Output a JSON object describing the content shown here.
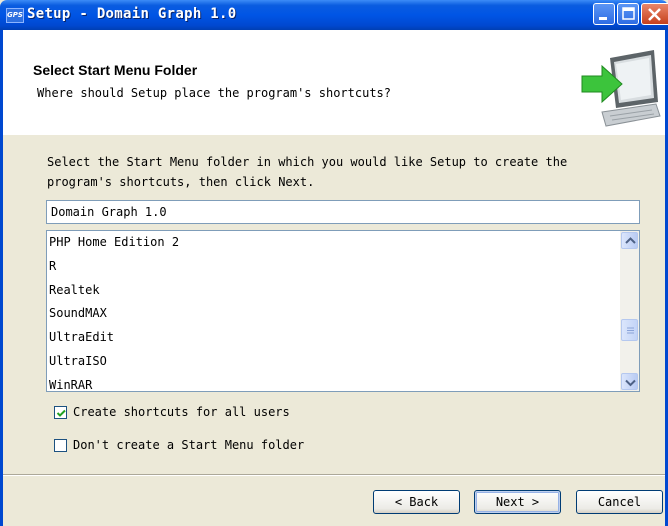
{
  "window": {
    "title": "Setup - Domain Graph 1.0",
    "app_icon_text": "GPS"
  },
  "header": {
    "title": "Select Start Menu Folder",
    "subtitle": "Where should Setup place the program's shortcuts?"
  },
  "body": {
    "instruction_line1": "Select the Start Menu folder in which you would like Setup to create the",
    "instruction_line2": "program's shortcuts, then click Next.",
    "folder_value": "Domain Graph 1.0",
    "folders": [
      "PHP Home Edition 2",
      "R",
      "Realtek",
      "SoundMAX",
      "UltraEdit",
      "UltraISO",
      "WinRAR"
    ]
  },
  "options": {
    "all_users_label": "Create shortcuts for all users",
    "all_users_checked": true,
    "no_folder_label": "Don't create a Start Menu folder",
    "no_folder_checked": false
  },
  "footer": {
    "back_label": "< Back",
    "next_label": "Next >",
    "cancel_label": "Cancel"
  },
  "colors": {
    "titlebar": "#0055e5",
    "dialog_bg": "#ece9d8",
    "header_bg": "#ffffff",
    "arrow": "#3cc43c"
  }
}
